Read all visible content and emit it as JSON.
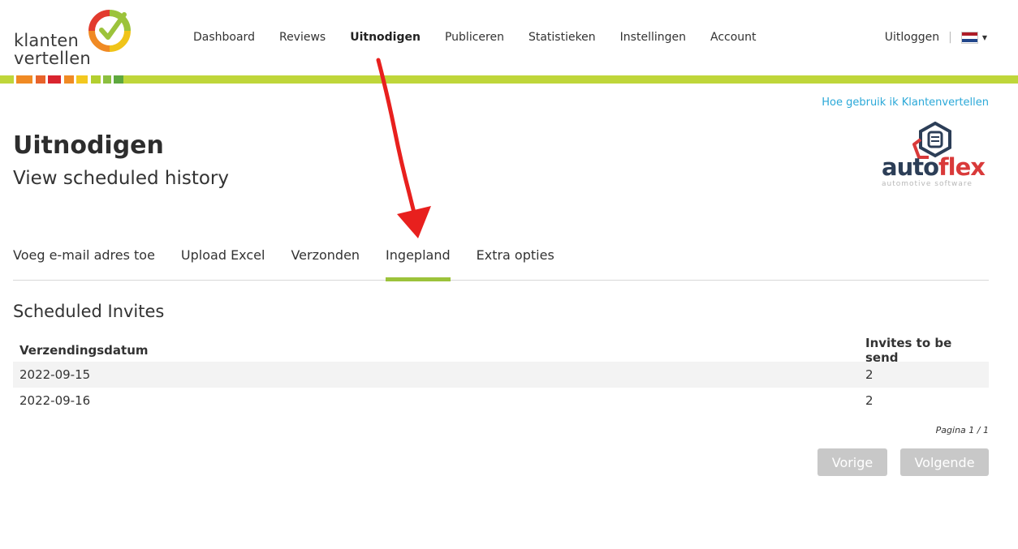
{
  "logo": {
    "line1": "klanten",
    "line2": "vertellen"
  },
  "nav": {
    "items": [
      {
        "label": "Dashboard",
        "active": false
      },
      {
        "label": "Reviews",
        "active": false
      },
      {
        "label": "Uitnodigen",
        "active": true
      },
      {
        "label": "Publiceren",
        "active": false
      },
      {
        "label": "Statistieken",
        "active": false
      },
      {
        "label": "Instellingen",
        "active": false
      },
      {
        "label": "Account",
        "active": false
      }
    ],
    "logout": "Uitloggen",
    "separator": "|",
    "language_icon": "dutch-flag-icon"
  },
  "help_link": "Hoe gebruik ik Klantenvertellen",
  "page": {
    "title": "Uitnodigen",
    "subtitle": "View scheduled history"
  },
  "brand": {
    "name_part1": "auto",
    "name_part2": "flex",
    "tagline": "automotive software"
  },
  "tabs": [
    {
      "label": "Voeg e-mail adres toe",
      "active": false
    },
    {
      "label": "Upload Excel",
      "active": false
    },
    {
      "label": "Verzonden",
      "active": false
    },
    {
      "label": "Ingepland",
      "active": true
    },
    {
      "label": "Extra opties",
      "active": false
    }
  ],
  "section_title": "Scheduled Invites",
  "table": {
    "headers": [
      "Verzendingsdatum",
      "Invites to be send"
    ],
    "rows": [
      [
        "2022-09-15",
        "2"
      ],
      [
        "2022-09-16",
        "2"
      ]
    ]
  },
  "pagination": {
    "info": "Pagina 1 / 1",
    "prev": "Vorige",
    "next": "Volgende"
  },
  "colors": {
    "accent_green": "#bfd63a",
    "tab_active": "#9cc33b",
    "link_blue": "#2aa8d8",
    "annotation_red": "#e8201e",
    "button_disabled": "#c8c8c8"
  }
}
